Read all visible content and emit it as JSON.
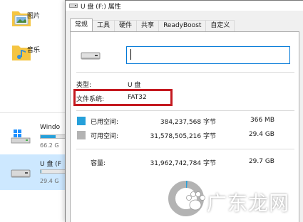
{
  "explorer": {
    "libraries": [
      {
        "label": "图片",
        "icon": "pictures-folder-icon"
      },
      {
        "label": "音乐",
        "icon": "music-folder-icon"
      }
    ],
    "drives": [
      {
        "name": "Windo",
        "free": "66.2 G",
        "used_fraction": 0.55,
        "icon": "windows-drive-icon"
      },
      {
        "name": "U 盘 (F",
        "free": "29.4 G",
        "used_fraction": 0.03,
        "icon": "usb-drive-icon"
      }
    ]
  },
  "window": {
    "title": "U 盘 (F:) 属性",
    "tabs": [
      {
        "label": "常规",
        "active": true
      },
      {
        "label": "工具",
        "active": false
      },
      {
        "label": "硬件",
        "active": false
      },
      {
        "label": "共享",
        "active": false
      },
      {
        "label": "ReadyBoost",
        "active": false
      },
      {
        "label": "自定义",
        "active": false
      }
    ],
    "general": {
      "name_value": "",
      "type_label": "类型:",
      "type_value": "U 盘",
      "fs_label": "文件系统:",
      "fs_value": "FAT32",
      "used_label": "已用空间:",
      "used_bytes": "384,237,568 字节",
      "used_size": "366 MB",
      "free_label": "可用空间:",
      "free_bytes": "31,578,505,216 字节",
      "free_size": "29.4 GB",
      "capacity_label": "容量:",
      "capacity_bytes": "31,962,742,784 字节",
      "capacity_size": "29.7 GB",
      "used_fraction": 0.012
    }
  },
  "watermark": "广东龙网",
  "colors": {
    "used": "#26a0da",
    "free": "#b3b3b3",
    "highlight": "#c4191f",
    "accent": "#0078d7"
  }
}
